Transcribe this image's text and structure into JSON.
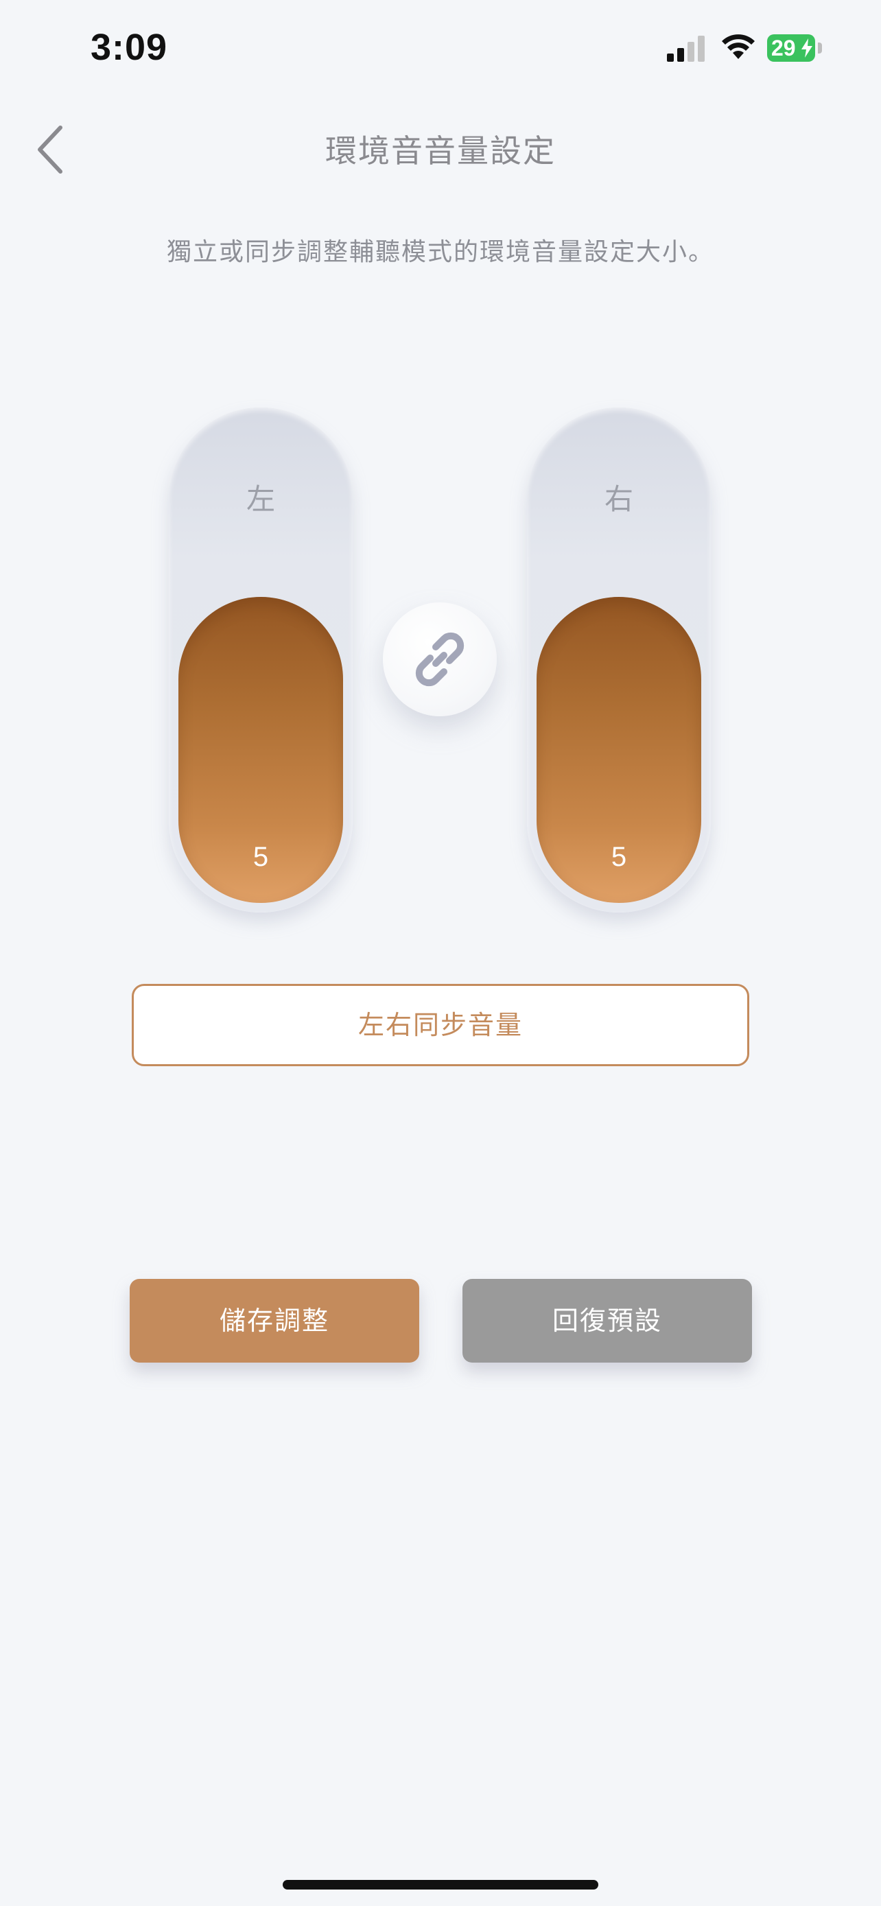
{
  "status_bar": {
    "time": "3:09",
    "battery_level": "29",
    "icons": [
      "signal-icon",
      "wifi-icon",
      "battery-charging-icon"
    ]
  },
  "header": {
    "back_icon": "chevron-left-icon",
    "title": "環境音音量設定"
  },
  "description": "獨立或同步調整輔聽模式的環境音量設定大小。",
  "sliders": {
    "left": {
      "label": "左",
      "value": "5"
    },
    "right": {
      "label": "右",
      "value": "5"
    }
  },
  "link_icon": "link-icon",
  "sync_button_label": "左右同步音量",
  "actions": {
    "save_label": "儲存調整",
    "reset_label": "回復預設"
  },
  "colors": {
    "accent": "#c48b5c",
    "slider_fill_top": "#955723",
    "slider_fill_bottom": "#e0a066",
    "reset_gray": "#9a9a9a",
    "background": "#f4f6f9"
  }
}
